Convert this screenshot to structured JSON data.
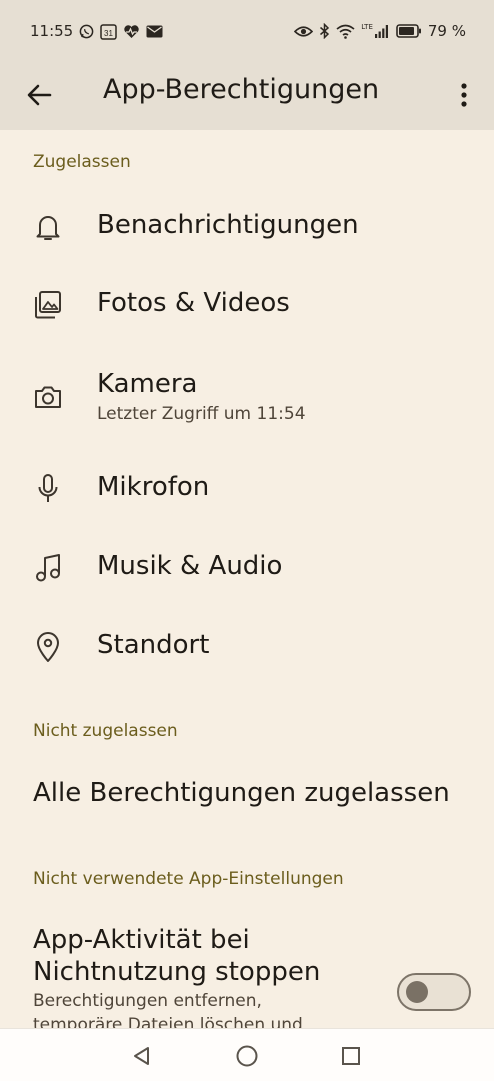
{
  "status_bar": {
    "time": "11:55",
    "calendar_day": "31",
    "battery": "79 %",
    "network": "LTE"
  },
  "app_bar": {
    "title": "App-Berechtigungen"
  },
  "sections": {
    "allowed": {
      "header": "Zugelassen",
      "items": [
        {
          "label": "Benachrichtigungen",
          "icon": "bell-icon"
        },
        {
          "label": "Fotos & Videos",
          "icon": "photos-icon"
        },
        {
          "label": "Kamera",
          "sublabel": "Letzter Zugriff um 11:54",
          "icon": "camera-icon"
        },
        {
          "label": "Mikrofon",
          "icon": "microphone-icon"
        },
        {
          "label": "Musik & Audio",
          "icon": "music-note-icon"
        },
        {
          "label": "Standort",
          "icon": "location-pin-icon"
        }
      ]
    },
    "not_allowed": {
      "header": "Nicht zugelassen",
      "allow_all_label": "Alle Berechtigungen zugelassen"
    },
    "unused": {
      "header": "Nicht verwendete App-Einstellungen",
      "pause_title_line1": "App-Aktivität bei",
      "pause_title_line2": "Nichtnutzung stoppen",
      "pause_desc_line1": "Berechtigungen entfernen,",
      "pause_desc_line2": "temporäre Dateien löschen und",
      "toggle_on": false
    }
  },
  "colors": {
    "background": "#f7efe3",
    "app_bar": "#e6dfd3",
    "section_header": "#6b5d1d"
  }
}
